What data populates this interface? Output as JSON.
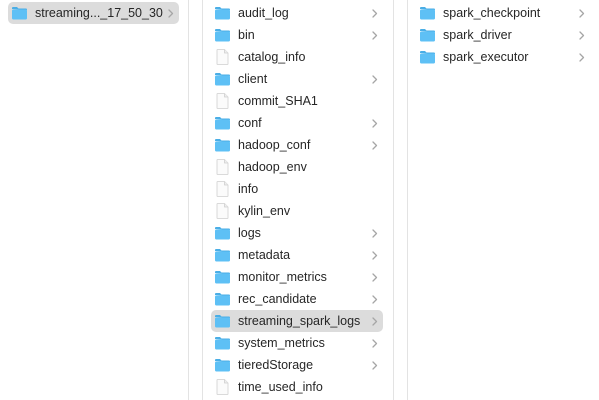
{
  "colors": {
    "folder": "#5ec0f5",
    "folder_tab": "#4aaee6",
    "selection": "#dcdcdc",
    "chevron": "#a6a6a6",
    "text": "#262626"
  },
  "columns": [
    {
      "items": [
        {
          "label": "streaming..._17_50_30",
          "kind": "folder",
          "icon": "folder-icon",
          "selected": true
        }
      ]
    },
    {
      "items": [
        {
          "label": "audit_log",
          "kind": "folder",
          "icon": "folder-icon"
        },
        {
          "label": "bin",
          "kind": "folder",
          "icon": "folder-icon"
        },
        {
          "label": "catalog_info",
          "kind": "file",
          "icon": "document-icon"
        },
        {
          "label": "client",
          "kind": "folder",
          "icon": "folder-icon"
        },
        {
          "label": "commit_SHA1",
          "kind": "file",
          "icon": "document-icon"
        },
        {
          "label": "conf",
          "kind": "folder",
          "icon": "folder-icon"
        },
        {
          "label": "hadoop_conf",
          "kind": "folder",
          "icon": "folder-icon"
        },
        {
          "label": "hadoop_env",
          "kind": "file",
          "icon": "document-icon"
        },
        {
          "label": "info",
          "kind": "file",
          "icon": "document-icon"
        },
        {
          "label": "kylin_env",
          "kind": "file",
          "icon": "document-icon"
        },
        {
          "label": "logs",
          "kind": "folder",
          "icon": "folder-icon"
        },
        {
          "label": "metadata",
          "kind": "folder",
          "icon": "folder-icon"
        },
        {
          "label": "monitor_metrics",
          "kind": "folder",
          "icon": "folder-icon"
        },
        {
          "label": "rec_candidate",
          "kind": "folder",
          "icon": "folder-icon"
        },
        {
          "label": "streaming_spark_logs",
          "kind": "folder",
          "icon": "folder-icon",
          "selected": true
        },
        {
          "label": "system_metrics",
          "kind": "folder",
          "icon": "folder-icon"
        },
        {
          "label": "tieredStorage",
          "kind": "folder",
          "icon": "folder-icon"
        },
        {
          "label": "time_used_info",
          "kind": "file",
          "icon": "document-icon"
        }
      ]
    },
    {
      "items": [
        {
          "label": "spark_checkpoint",
          "kind": "folder",
          "icon": "folder-icon"
        },
        {
          "label": "spark_driver",
          "kind": "folder",
          "icon": "folder-icon"
        },
        {
          "label": "spark_executor",
          "kind": "folder",
          "icon": "folder-icon"
        }
      ]
    }
  ]
}
